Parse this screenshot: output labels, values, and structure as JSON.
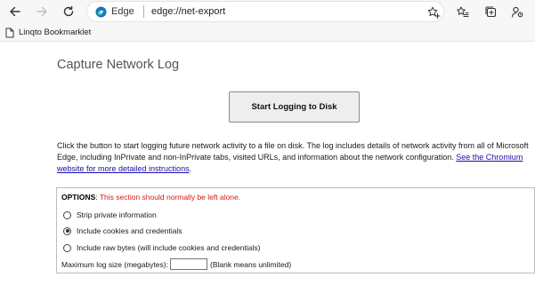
{
  "toolbar": {
    "site_label": "Edge",
    "url": "edge://net-export"
  },
  "bookmarks": [
    {
      "label": "Linqto Bookmarklet"
    }
  ],
  "page": {
    "title": "Capture Network Log",
    "start_button": "Start Logging to Disk",
    "description": "Click the button to start logging future network activity to a file on disk. The log includes details of network activity from all of Microsoft Edge, including InPrivate and non-InPrivate tabs, visited URLs, and information about the network configuration.",
    "description_link": "See the Chromium website for more detailed instructions",
    "description_end": "."
  },
  "options": {
    "heading": "OPTIONS",
    "warning": "This section should normally be left alone.",
    "radios": [
      {
        "label": "Strip private information",
        "checked": false
      },
      {
        "label": "Include cookies and credentials",
        "checked": true
      },
      {
        "label": "Include raw bytes (will include cookies and credentials)",
        "checked": false
      }
    ],
    "max_size_label": "Maximum log size (megabytes):",
    "max_size_value": "",
    "max_size_hint": "(Blank means unlimited)"
  }
}
